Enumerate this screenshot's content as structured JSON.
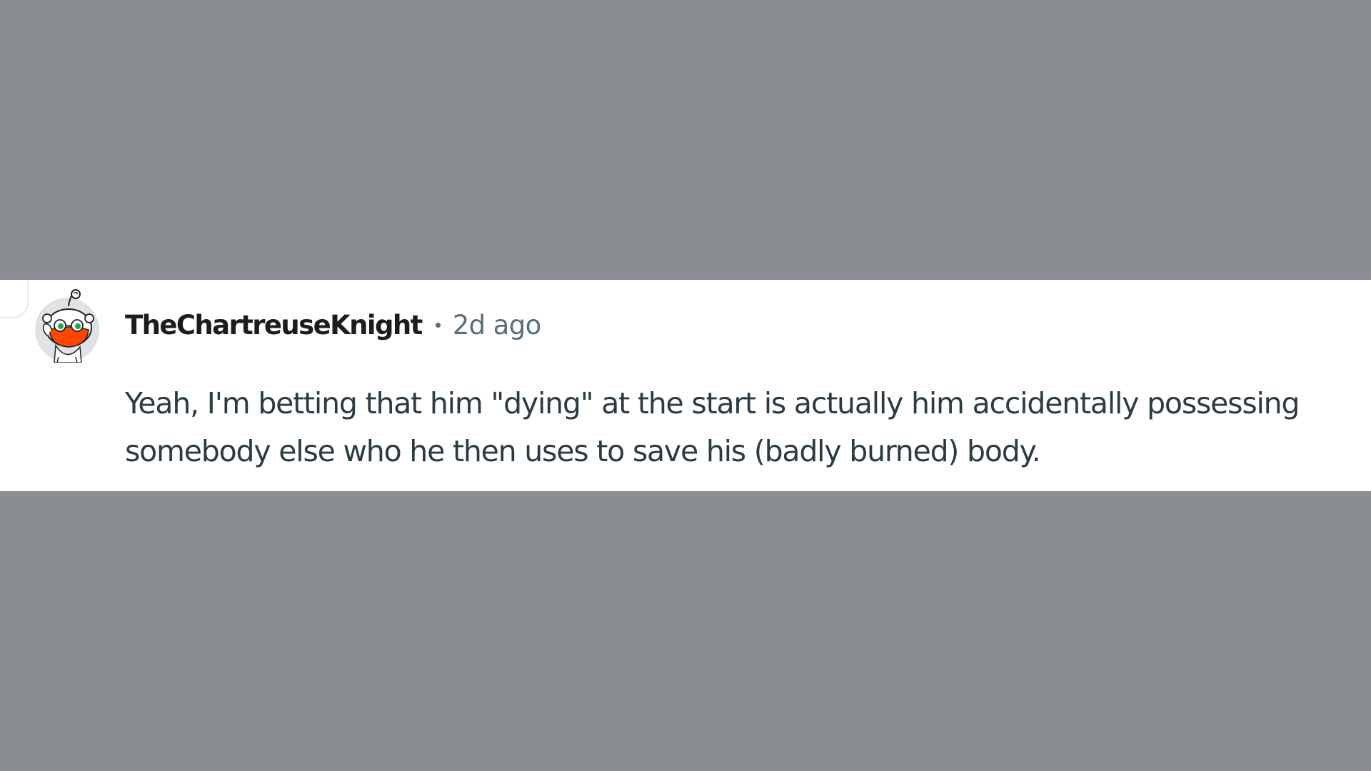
{
  "comment": {
    "author": "TheChartreuseKnight",
    "age": "2d ago",
    "body_lines": [
      "Yeah, I'm betting that him \"dying\" at the start is actually him accidentally possessing",
      "somebody else who he then uses to save his (badly burned) body."
    ]
  },
  "colors": {
    "backdrop": "#8a8e92",
    "card": "#ffffff",
    "author_text": "#1c1c1c",
    "meta_text": "#576f76",
    "body_text": "#2a3c42",
    "avatar_accent": "#ff4500"
  },
  "icons": {
    "avatar": "snoo-avatar-icon"
  }
}
